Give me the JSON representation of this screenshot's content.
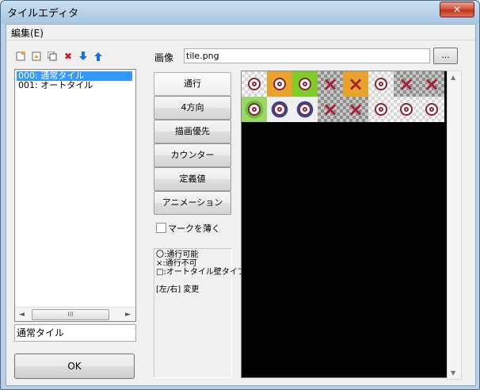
{
  "window": {
    "title": "タイルエディタ",
    "close_label": "✕"
  },
  "menu": {
    "edit": "編集(E)"
  },
  "toolbar": {
    "icons": [
      "new-icon",
      "import-icon",
      "copy-icon",
      "delete-icon",
      "move-down-icon",
      "move-up-icon"
    ],
    "colors": {
      "new": "#e8a030",
      "delete": "#d01818",
      "arrow": "#1a6fd8"
    }
  },
  "tileset_list": {
    "items": [
      "000: 通常タイル",
      "001: オートタイル"
    ],
    "selected_index": 0,
    "scroll_thumb_label": "III"
  },
  "name_field": {
    "value": "通常タイル"
  },
  "ok_button": {
    "label": "OK"
  },
  "image": {
    "label": "画像",
    "value": "tile.png",
    "browse_label": "..."
  },
  "modes": [
    "通行",
    "4方向",
    "描画優先",
    "カウンター",
    "定義値",
    "アニメーション"
  ],
  "active_mode": "通行",
  "option": {
    "label": "マークを薄く",
    "checked": false
  },
  "legend": {
    "lines": [
      "〇:通行可能",
      "×:通行不可",
      "□:オートタイル壁タイプ"
    ],
    "hint": "[左/右] 変更"
  },
  "tiles": {
    "row1": [
      {
        "base": "check",
        "mark": "circle"
      },
      {
        "base": "sand",
        "mark": "circle"
      },
      {
        "base": "grass",
        "mark": "circle"
      },
      {
        "base": "stone",
        "mark": "x"
      },
      {
        "base": "sand",
        "mark": "x"
      },
      {
        "base": "check",
        "mark": "circle"
      },
      {
        "base": "stone",
        "mark": "x"
      },
      {
        "base": "stone",
        "mark": "x"
      }
    ],
    "row2": [
      {
        "base": "bush",
        "mark": "circle"
      },
      {
        "base": "pond",
        "mark": "circle"
      },
      {
        "base": "pond",
        "mark": "circle"
      },
      {
        "base": "stone",
        "mark": "x"
      },
      {
        "base": "stone",
        "mark": "x"
      },
      {
        "base": "check",
        "mark": "circle"
      },
      {
        "base": "check",
        "mark": "circle"
      },
      {
        "base": "check",
        "mark": "circle"
      }
    ]
  }
}
